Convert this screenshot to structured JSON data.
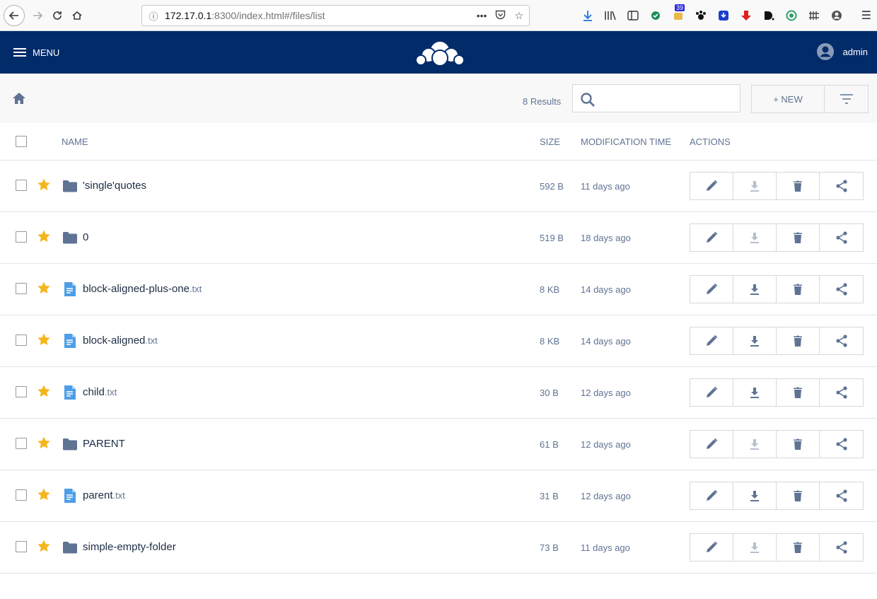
{
  "browser": {
    "url_host": "172.17.0.1",
    "url_rest": ":8300/index.html#/files/list",
    "badge_count": "39"
  },
  "header": {
    "menu_label": "MENU",
    "username": "admin"
  },
  "toolbar": {
    "results": "8 Results",
    "search_placeholder": "",
    "new_label": "+ NEW"
  },
  "table": {
    "columns": {
      "name": "NAME",
      "size": "SIZE",
      "mtime": "MODIFICATION TIME",
      "actions": "ACTIONS"
    },
    "rows": [
      {
        "name": "'single'quotes",
        "ext": "",
        "type": "folder",
        "size": "592 B",
        "mtime": "11 days ago"
      },
      {
        "name": "0",
        "ext": "",
        "type": "folder",
        "size": "519 B",
        "mtime": "18 days ago"
      },
      {
        "name": "block-aligned-plus-one",
        "ext": ".txt",
        "type": "file",
        "size": "8 KB",
        "mtime": "14 days ago"
      },
      {
        "name": "block-aligned",
        "ext": ".txt",
        "type": "file",
        "size": "8 KB",
        "mtime": "14 days ago"
      },
      {
        "name": "child",
        "ext": ".txt",
        "type": "file",
        "size": "30 B",
        "mtime": "12 days ago"
      },
      {
        "name": "PARENT",
        "ext": "",
        "type": "folder",
        "size": "61 B",
        "mtime": "12 days ago"
      },
      {
        "name": "parent",
        "ext": ".txt",
        "type": "file",
        "size": "31 B",
        "mtime": "12 days ago"
      },
      {
        "name": "simple-empty-folder",
        "ext": "",
        "type": "folder",
        "size": "73 B",
        "mtime": "11 days ago"
      }
    ]
  },
  "colors": {
    "header_bg": "#022b69",
    "star": "#f5b51d",
    "folder": "#5f7393",
    "file": "#4c9ee8",
    "action_icon": "#5f7393",
    "action_disabled": "#b5bfcf"
  }
}
